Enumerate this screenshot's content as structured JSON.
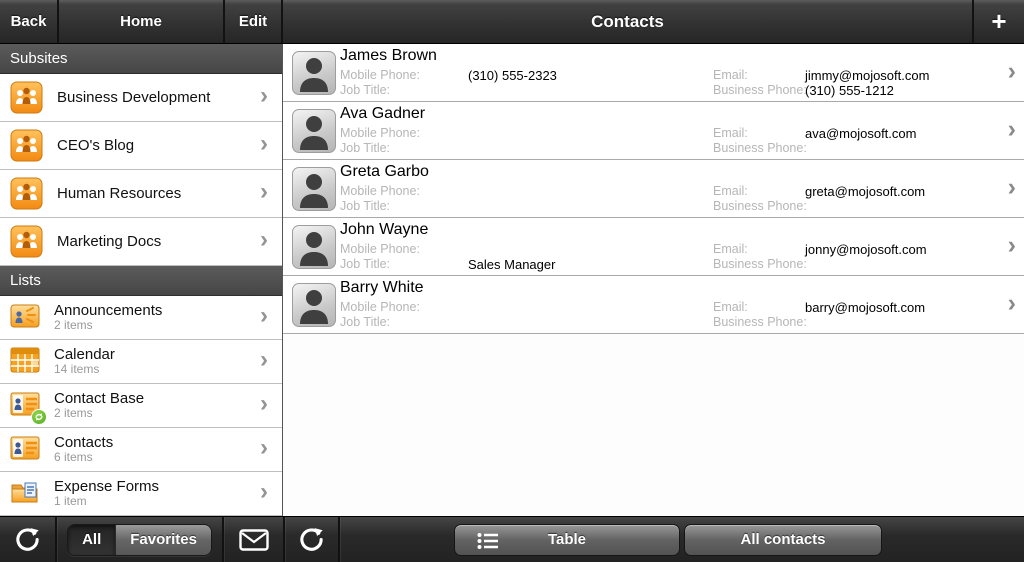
{
  "topbar": {
    "back_label": "Back",
    "home_label": "Home",
    "edit_label": "Edit",
    "title": "Contacts",
    "add_label": "+"
  },
  "sidebar": {
    "subsites_header": "Subsites",
    "subsites": [
      {
        "label": "Business Development",
        "icon": "team-site-icon"
      },
      {
        "label": "CEO's Blog",
        "icon": "team-site-icon"
      },
      {
        "label": "Human Resources",
        "icon": "team-site-icon"
      },
      {
        "label": "Marketing Docs",
        "icon": "team-site-icon"
      }
    ],
    "lists_header": "Lists",
    "lists": [
      {
        "label": "Announcements",
        "count": "2 items",
        "icon": "announcement-icon"
      },
      {
        "label": "Calendar",
        "count": "14 items",
        "icon": "calendar-icon"
      },
      {
        "label": "Contact Base",
        "count": "2 items",
        "icon": "contact-card-icon",
        "badge": "sync-badge-icon"
      },
      {
        "label": "Contacts",
        "count": "6 items",
        "icon": "contact-card-icon"
      },
      {
        "label": "Expense Forms",
        "count": "1 item",
        "icon": "folder-document-icon"
      }
    ],
    "chevron_glyph": "›"
  },
  "contacts": {
    "field_labels": {
      "mobile": "Mobile Phone:",
      "job": "Job Title:",
      "email": "Email:",
      "business": "Business Phone:"
    },
    "rows": [
      {
        "name": "James Brown",
        "mobile": "(310) 555-2323",
        "job": "",
        "email": "jimmy@mojosoft.com",
        "business": "(310) 555-1212"
      },
      {
        "name": "Ava Gadner",
        "mobile": "",
        "job": "",
        "email": "ava@mojosoft.com",
        "business": ""
      },
      {
        "name": "Greta Garbo",
        "mobile": "",
        "job": "",
        "email": "greta@mojosoft.com",
        "business": ""
      },
      {
        "name": "John Wayne",
        "mobile": "",
        "job": "Sales Manager",
        "email": "jonny@mojosoft.com",
        "business": ""
      },
      {
        "name": "Barry White",
        "mobile": "",
        "job": "",
        "email": "barry@mojosoft.com",
        "business": ""
      }
    ],
    "chevron_glyph": "›"
  },
  "bottombar": {
    "segmented": {
      "all_label": "All",
      "favorites_label": "Favorites",
      "selected": "All"
    },
    "table_button_label": "Table",
    "all_contacts_button_label": "All contacts",
    "icons": [
      "refresh-icon",
      "envelope-icon",
      "refresh-icon",
      "list-view-icon"
    ]
  },
  "colors": {
    "accent_orange": "#f7941e",
    "badge_green": "#5fb32a",
    "bar_dark": "#2e2e2e",
    "label_gray": "#b6b6b6"
  }
}
